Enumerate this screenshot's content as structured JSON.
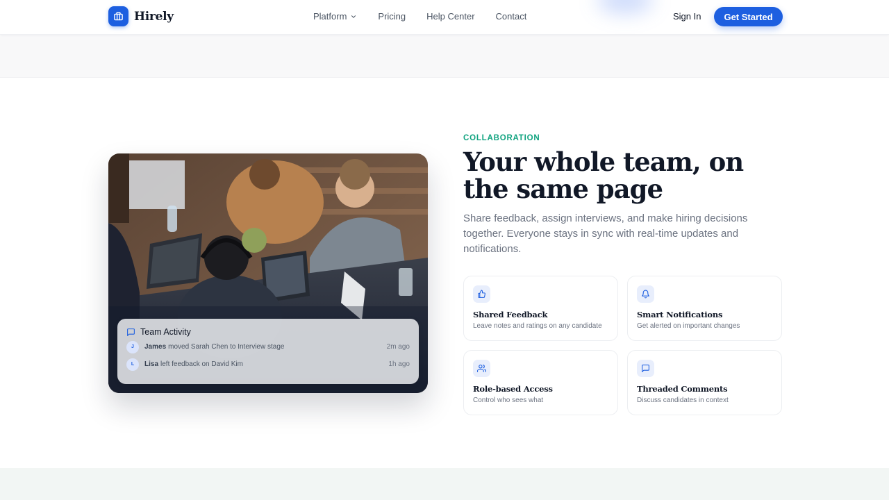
{
  "brand": {
    "name": "Hirely",
    "accent": "#1d5fe0",
    "eyebrow_color": "#10a37f"
  },
  "nav": {
    "items": [
      {
        "label": "Platform",
        "has_dropdown": true
      },
      {
        "label": "Pricing"
      },
      {
        "label": "Help Center"
      },
      {
        "label": "Contact"
      }
    ],
    "sign_in": "Sign In",
    "cta": "Get Started"
  },
  "section": {
    "eyebrow": "COLLABORATION",
    "headline": "Your whole team, on the same page",
    "lead": "Share feedback, assign interviews, and make hiring decisions together. Everyone stays in sync with real-time updates and notifications."
  },
  "activity": {
    "title": "Team Activity",
    "rows": [
      {
        "initial": "J",
        "name": "James",
        "text": "moved Sarah Chen to Interview stage",
        "time": "2m ago"
      },
      {
        "initial": "L",
        "name": "Lisa",
        "text": "left feedback on David Kim",
        "time": "1h ago"
      }
    ]
  },
  "features": [
    {
      "icon": "thumbs-up-icon",
      "title": "Shared Feedback",
      "desc": "Leave notes and ratings on any candidate"
    },
    {
      "icon": "bell-icon",
      "title": "Smart Notifications",
      "desc": "Get alerted on important changes"
    },
    {
      "icon": "users-icon",
      "title": "Role-based Access",
      "desc": "Control who sees what"
    },
    {
      "icon": "comment-icon",
      "title": "Threaded Comments",
      "desc": "Discuss candidates in context"
    }
  ]
}
